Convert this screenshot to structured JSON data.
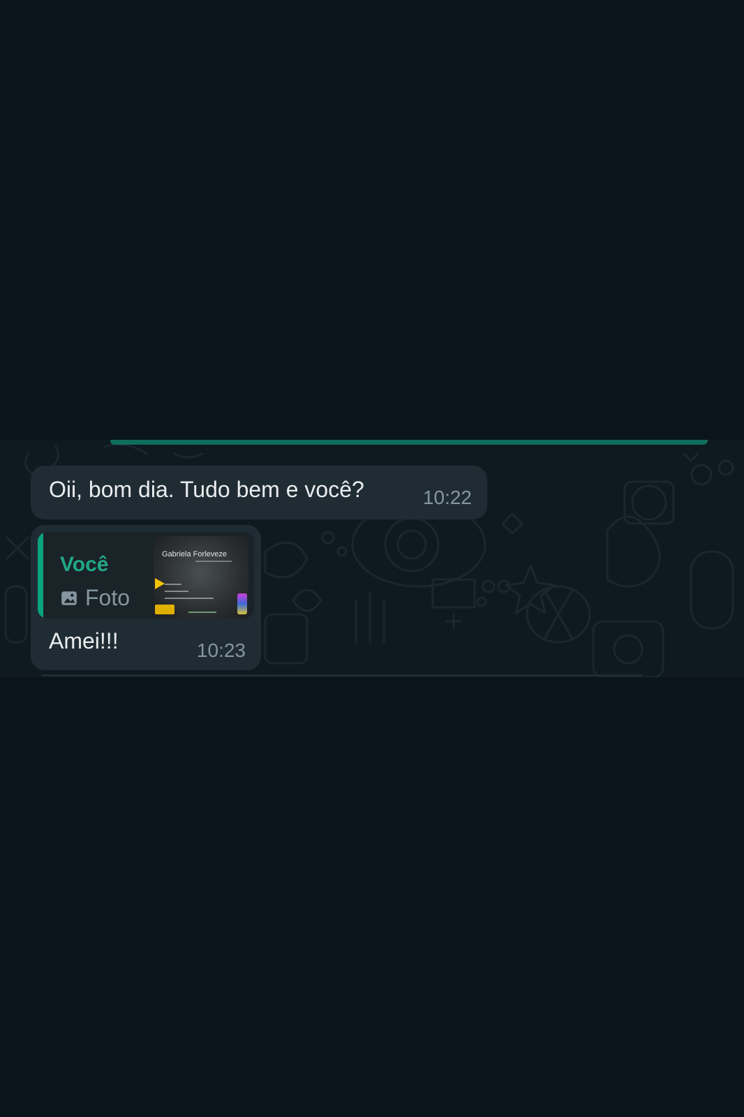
{
  "messages": [
    {
      "text": "Oii, bom dia. Tudo bem e você?",
      "time": "10:22"
    },
    {
      "text": "Amei!!!",
      "time": "10:23",
      "quoted": {
        "author": "Você",
        "type_icon": "photo-icon",
        "type_label": "Foto",
        "thumbnail_title": "Gabriela Forleveze"
      }
    }
  ],
  "colors": {
    "background": "#0b141a",
    "bubble": "#202c33",
    "quote_author": "#21a884",
    "accent_bar": "#06cf9c",
    "timestamp": "#8696a0"
  }
}
